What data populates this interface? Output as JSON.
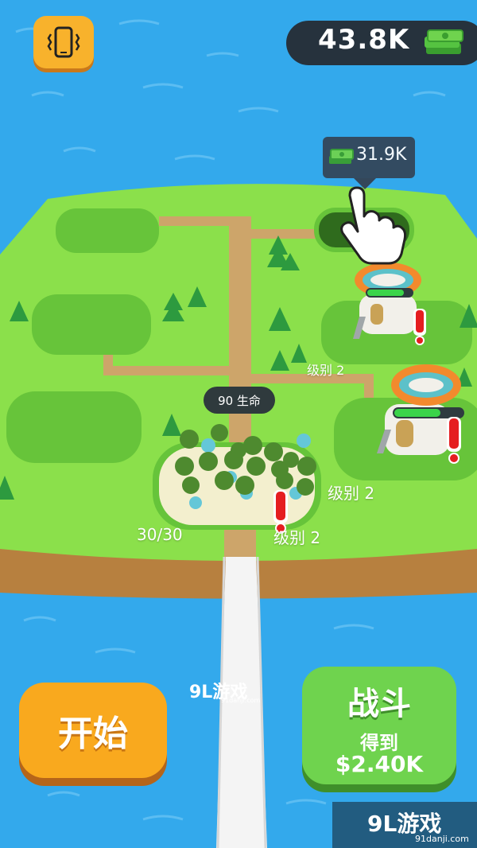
{
  "hud": {
    "money": "43.8K",
    "vibrate_icon": "phone-vibrate-icon",
    "cash_icon": "cash-stack-icon"
  },
  "plot_bubble": {
    "price": "31.9K",
    "cash_icon": "cash-stack-icon",
    "hand_icon": "pointing-hand-icon"
  },
  "island": {
    "army_hp": "90 生命",
    "army_count": "30/30",
    "level_label_1": "级别 2",
    "level_label_2": "级别 2",
    "level_label_3": "级别 2",
    "level_label_4": "级别 2",
    "alert_icon": "exclamation-icon"
  },
  "buttons": {
    "start_label": "开始",
    "battle_title": "战斗",
    "battle_sub": "得到",
    "battle_reward": "$2.40K"
  },
  "watermark": {
    "logo": "9L游戏",
    "url": "91danji.com"
  },
  "colors": {
    "water": "#33a9ec",
    "grass": "#8be04b",
    "grass_dark": "#67c43a",
    "path": "#cda56a",
    "start_button": "#f9a91e",
    "battle_button": "#6fd34e",
    "hud_dark": "#26323d"
  }
}
